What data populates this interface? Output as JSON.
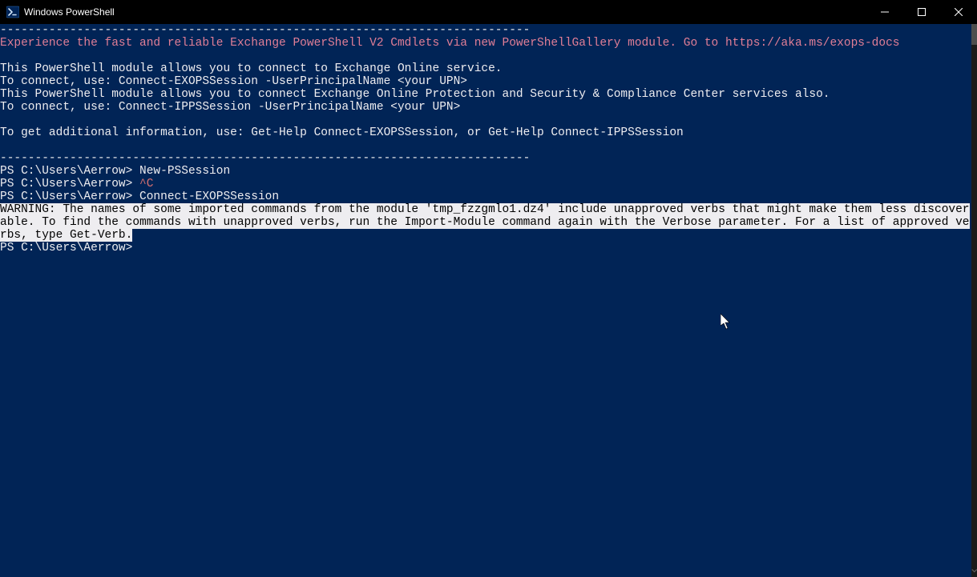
{
  "window": {
    "title": "Windows PowerShell"
  },
  "term": {
    "dash1": "----------------------------------------------------------------------------",
    "expLine": "Experience the fast and reliable Exchange PowerShell V2 Cmdlets via new PowerShellGallery module. Go to https://aka.ms/exops-docs",
    "blank": "",
    "info1": "This PowerShell module allows you to connect to Exchange Online service.",
    "info2": "To connect, use: Connect-EXOPSSession -UserPrincipalName <your UPN>",
    "info3": "This PowerShell module allows you to connect Exchange Online Protection and Security & Compliance Center services also.",
    "info4": "To connect, use: Connect-IPPSSession -UserPrincipalName <your UPN>",
    "info5": "To get additional information, use: Get-Help Connect-EXOPSSession, or Get-Help Connect-IPPSSession",
    "dash2": "----------------------------------------------------------------------------",
    "prompt": "PS C:\\Users\\Aerrow> ",
    "cmd1": "New-PSSession",
    "ctrlC": "^C",
    "cmd2": "Connect-EXOPSSession",
    "warn": "WARNING: The names of some imported commands from the module 'tmp_fzzgmlo1.dz4' include unapproved verbs that might make them less discoverable. To find the commands with unapproved verbs, run the Import-Module command again with the Verbose parameter. For a list of approved verbs, type Get-Verb."
  }
}
